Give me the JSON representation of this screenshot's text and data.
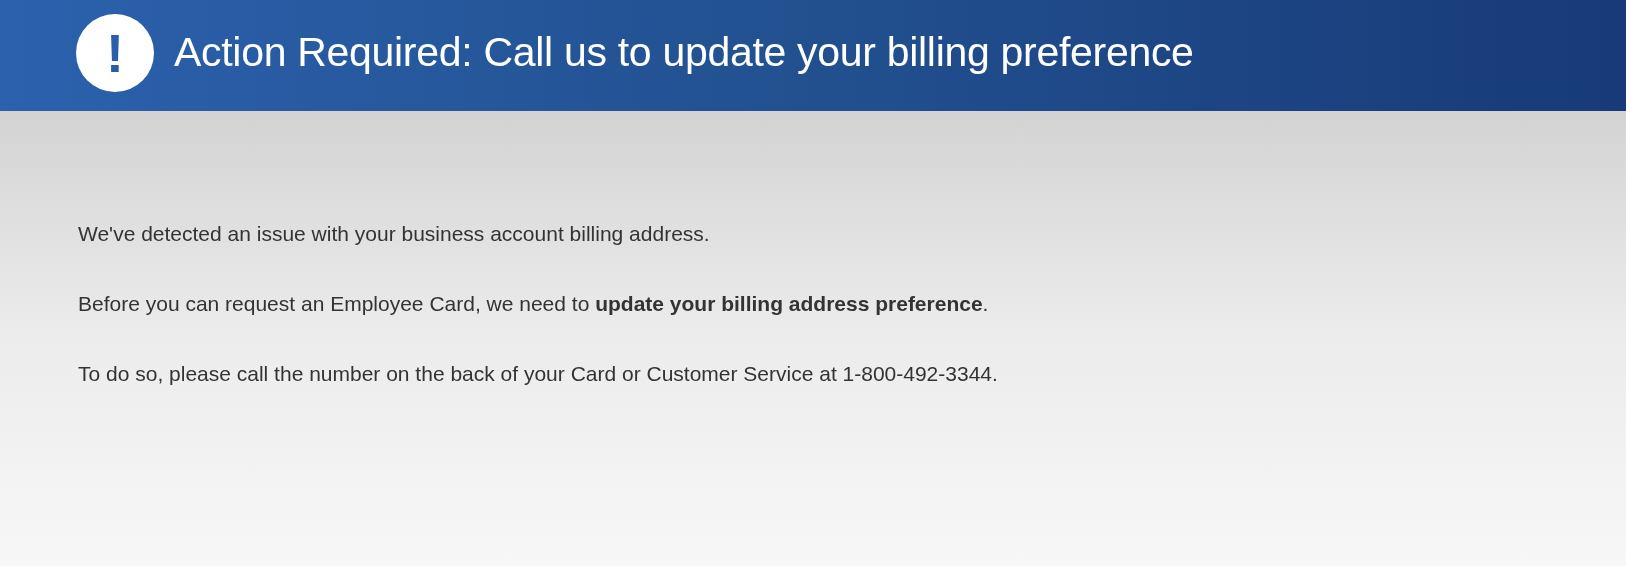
{
  "banner": {
    "icon": "!",
    "title": "Action Required: Call us to update your billing preference"
  },
  "paragraphs": [
    "We've detected an issue with your business account billing address.",
    "Before you can request an Employee Card, we need to **update your billing address preference**.",
    "To do so, please call the number on the back of your Card or Customer Service at 1-800-492-3344."
  ]
}
